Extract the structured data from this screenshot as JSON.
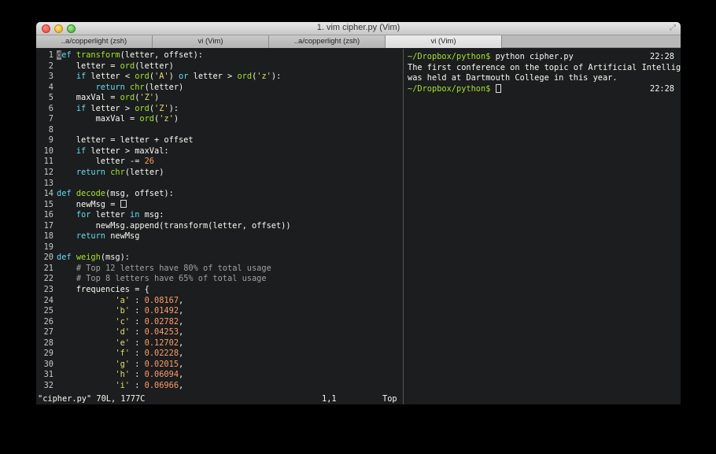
{
  "window": {
    "title": "1. vim cipher.py (Vim)",
    "tabs": [
      {
        "label": "..a/copperlight (zsh)",
        "active": false
      },
      {
        "label": "vi (Vim)",
        "active": false
      },
      {
        "label": "..a/copperlight (zsh)",
        "active": false
      },
      {
        "label": "vi (Vim)",
        "active": true
      }
    ]
  },
  "editor": {
    "status": {
      "file": "\"cipher.py\" 70L, 1777C",
      "position": "1,1",
      "scroll": "Top"
    },
    "line_numbers": [
      "1",
      "2",
      "3",
      "4",
      "5",
      "6",
      "7",
      "8",
      "9",
      "10",
      "11",
      "12",
      "13",
      "14",
      "15",
      "16",
      "17",
      "18",
      "19",
      "20",
      "21",
      "22",
      "23",
      "24",
      "25",
      "26",
      "27",
      "28",
      "29",
      "30",
      "31",
      "32"
    ]
  },
  "terminal": {
    "lines": [
      {
        "prompt": "~/Dropbox/python$",
        "command": " python cipher.py",
        "time": "22:28"
      },
      {
        "text": "The first conference on the topic of Artificial Intelligence"
      },
      {
        "text": "was held at Dartmouth College in this year."
      },
      {
        "prompt": "~/Dropbox/python$",
        "command": " ",
        "time": "22:28"
      }
    ]
  },
  "colors": {
    "background": "#1b1d1e",
    "keyword": "#66d9ef",
    "function": "#a6e22e",
    "string": "#e6db74",
    "number": "#ff9b6a",
    "comment": "#a0a0a0",
    "prompt": "#a6e22e"
  },
  "icons": [
    "close-icon",
    "minimize-icon",
    "maximize-icon",
    "fullscreen-icon"
  ]
}
